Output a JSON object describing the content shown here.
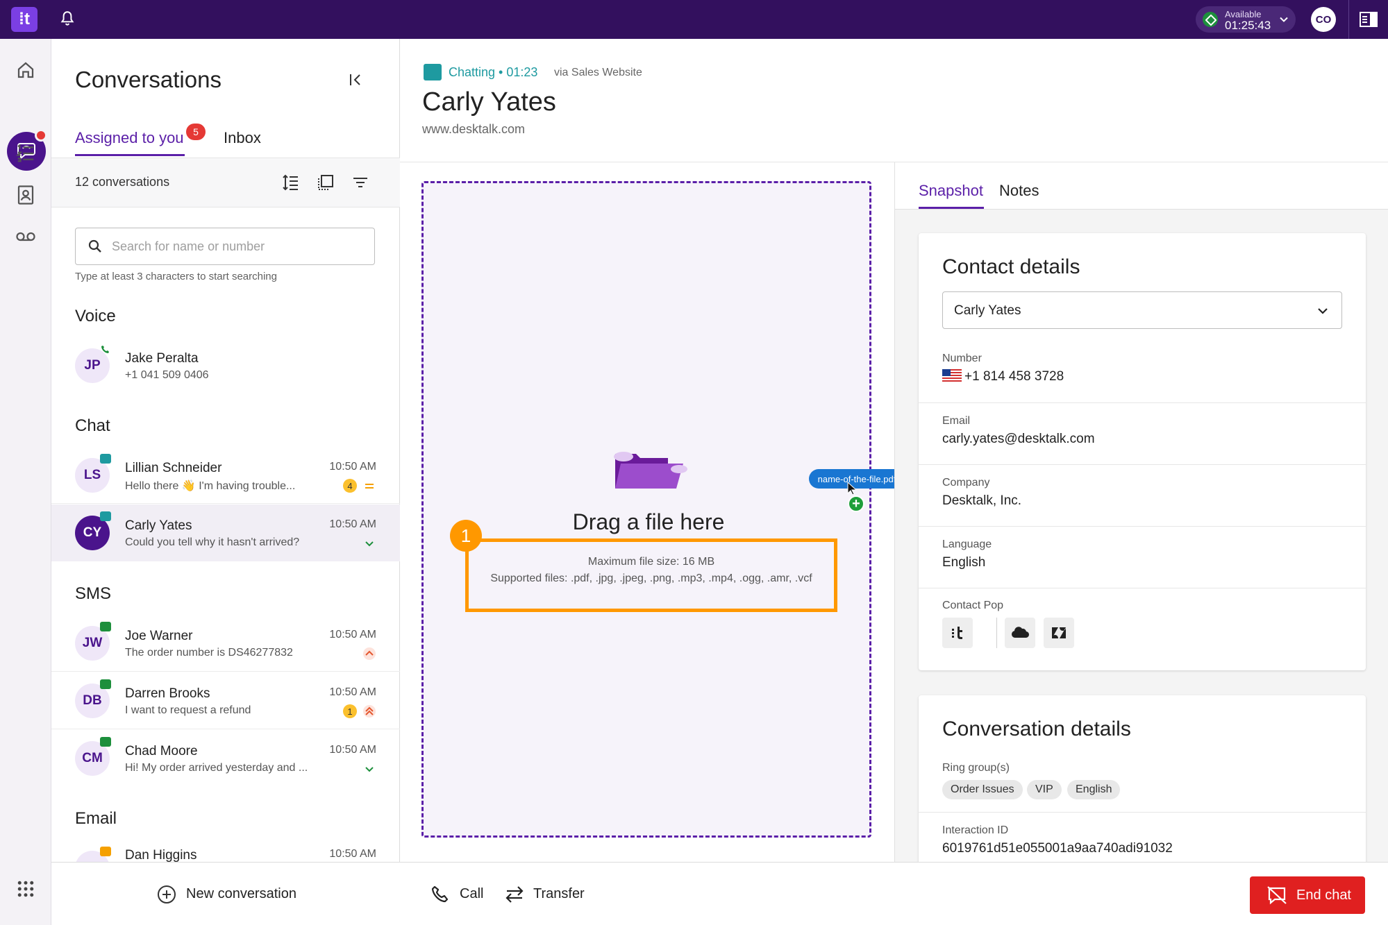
{
  "topbar": {
    "logo": "⁞t",
    "status": {
      "label": "Available",
      "time": "01:25:43"
    },
    "user_initials": "CO",
    "colors": {
      "bar": "#33105e",
      "status_green": "#1d8f3c"
    }
  },
  "rail": {
    "items": [
      "home-icon",
      "conversations-icon",
      "list-icon",
      "contacts-icon",
      "voicemail-icon",
      "apps-grid-icon"
    ]
  },
  "conversations": {
    "title": "Conversations",
    "tabs": {
      "assigned": "Assigned to you",
      "assigned_count": "5",
      "inbox": "Inbox"
    },
    "count_label": "12 conversations",
    "search": {
      "placeholder": "Search for name or number",
      "value": "",
      "hint": "Type at least 3 characters to start searching"
    },
    "sections": {
      "voice": "Voice",
      "chat": "Chat",
      "sms": "SMS",
      "email": "Email"
    },
    "voice_items": [
      {
        "initials": "JP",
        "name": "Jake Peralta",
        "preview": "+1 041 509 0406"
      }
    ],
    "chat_items": [
      {
        "initials": "LS",
        "name": "Lillian Schneider",
        "preview": "Hello there 👋 I'm having trouble...",
        "time": "10:50 AM",
        "count": "4",
        "priority": "medium"
      },
      {
        "initials": "CY",
        "name": "Carly Yates",
        "preview": "Could you tell why it hasn't arrived?",
        "time": "10:50 AM",
        "priority": "low"
      }
    ],
    "sms_items": [
      {
        "initials": "JW",
        "name": "Joe Warner",
        "preview": "The order number is DS46277832",
        "time": "10:50 AM",
        "priority": "high"
      },
      {
        "initials": "DB",
        "name": "Darren Brooks",
        "preview": "I want to request a refund",
        "time": "10:50 AM",
        "count": "1",
        "priority": "urgent"
      },
      {
        "initials": "CM",
        "name": "Chad Moore",
        "preview": "Hi! My order arrived yesterday and ...",
        "time": "10:50 AM",
        "priority": "low"
      }
    ],
    "email_items": [
      {
        "name": "Dan Higgins",
        "time": "10:50 AM"
      }
    ],
    "new_conversation": "New conversation"
  },
  "main": {
    "status": "Chatting • 01:23",
    "via": "via Sales Website",
    "contact_name": "Carly Yates",
    "contact_site": "www.desktalk.com",
    "dropzone": {
      "title": "Drag a file here",
      "max_size": "Maximum file size: 16 MB",
      "supported": "Supported files: .pdf, .jpg, .jpeg, .png, .mp3, .mp4, .ogg, .amr, .vcf",
      "step_number": "1",
      "dragged_file": "name-of-the-file.pdf"
    },
    "actions": {
      "call": "Call",
      "transfer": "Transfer",
      "end": "End chat"
    }
  },
  "snapshot": {
    "tabs": {
      "snapshot": "Snapshot",
      "notes": "Notes"
    },
    "contact_details": {
      "title": "Contact details",
      "selected_contact": "Carly Yates",
      "number_label": "Number",
      "number": "+1 814 458 3728",
      "email_label": "Email",
      "email": "carly.yates@desktalk.com",
      "company_label": "Company",
      "company": "Desktalk, Inc.",
      "language_label": "Language",
      "language": "English",
      "contact_pop_label": "Contact Pop"
    },
    "conversation_details": {
      "title": "Conversation details",
      "ring_groups_label": "Ring group(s)",
      "ring_groups": [
        "Order Issues",
        "VIP",
        "English"
      ],
      "interaction_id_label": "Interaction ID",
      "interaction_id": "6019761d51e055001a9aa740adi91032"
    }
  }
}
